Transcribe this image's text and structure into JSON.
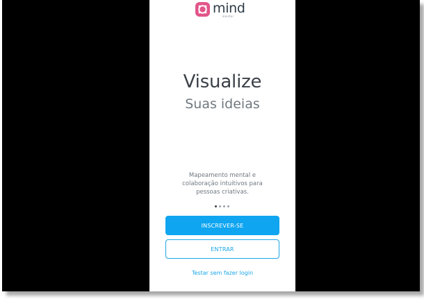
{
  "colors": {
    "brand_pink": "#e2558a",
    "primary_blue": "#0fa5f0",
    "link_blue": "#1aa6e8",
    "text_dark": "#3b4148",
    "text_muted": "#6f7880"
  },
  "logo": {
    "icon": "mindmeister-logo-icon",
    "word": "mind",
    "sub": "meister"
  },
  "onboarding": {
    "headline": "Visualize",
    "subheadline": "Suas ideias",
    "description": "Mapeamento mental e colaboração intuitivos para pessoas criativas.",
    "pager": {
      "current_page": 1,
      "total_pages": 4
    }
  },
  "actions": {
    "signup_label": "INSCREVER-SE",
    "login_label": "ENTRAR",
    "guest_label": "Testar sem fazer login"
  }
}
